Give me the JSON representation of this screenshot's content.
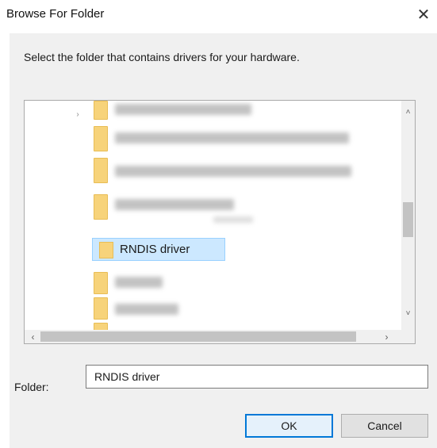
{
  "window": {
    "title": "Browse For Folder",
    "close_glyph": "✕"
  },
  "instruction": "Select the folder that contains drivers for your hardware.",
  "tree": {
    "selected_item": "RNDIS driver",
    "expander_glyph": "›",
    "scroll_up_glyph": "˄",
    "scroll_down_glyph": "˅",
    "scroll_left_glyph": "‹",
    "scroll_right_glyph": "›"
  },
  "folder_field": {
    "label": "Folder:",
    "value": "RNDIS driver"
  },
  "buttons": {
    "ok": "OK",
    "cancel": "Cancel"
  },
  "colors": {
    "selection_bg": "#cce8ff",
    "selection_border": "#99d1ff",
    "default_button_border": "#0078d7",
    "folder_icon": "#f7d37a"
  }
}
